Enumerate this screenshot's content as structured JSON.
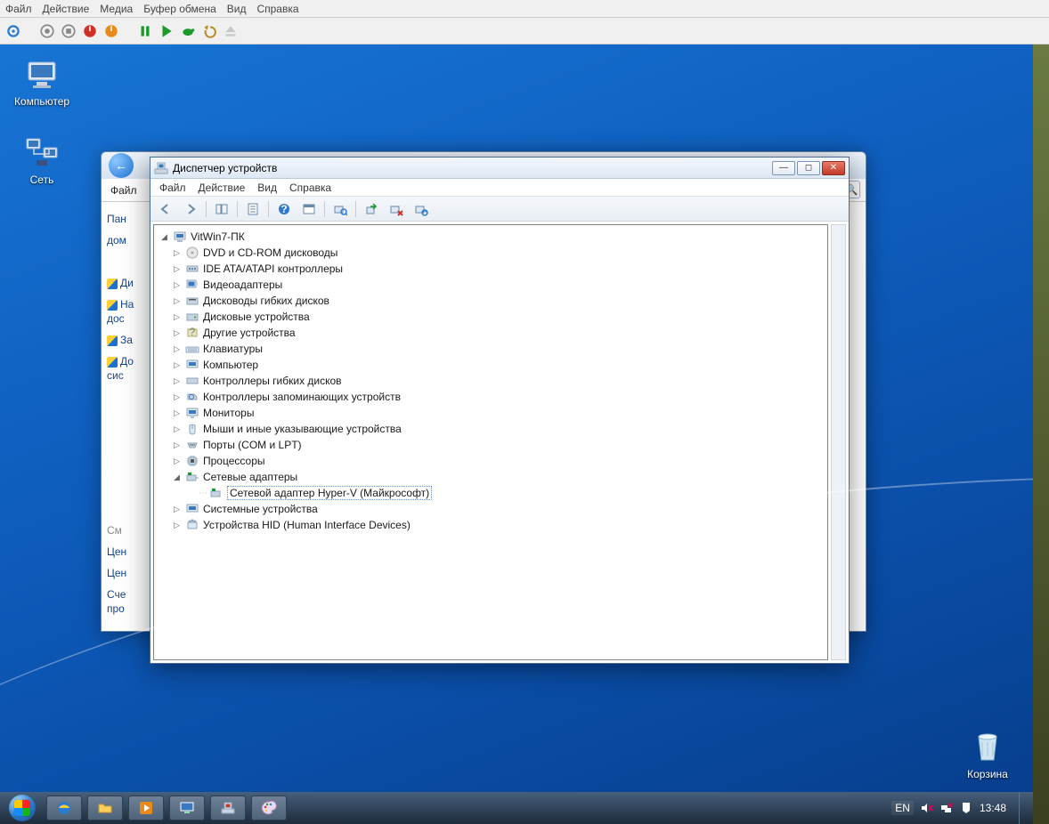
{
  "host": {
    "menu": {
      "file": "Файл",
      "action": "Действие",
      "media": "Медиа",
      "clipboard": "Буфер обмена",
      "view": "Вид",
      "help": "Справка"
    }
  },
  "desktop": {
    "computer": "Компьютер",
    "network": "Сеть",
    "recycle": "Корзина"
  },
  "cp": {
    "tab_file": "Файл",
    "side": {
      "panel": "Пан",
      "home": "дом",
      "disp": "Ди",
      "settings": "На",
      "dos": "дос",
      "protect": "За",
      "extra": "До",
      "sys": "сис",
      "see": "См",
      "center1": "Цен",
      "center2": "Цен",
      "acc": "Сче",
      "pro": "про"
    }
  },
  "dm": {
    "title": "Диспетчер устройств",
    "close_title": "Закрыть",
    "menu": {
      "file": "Файл",
      "action": "Действие",
      "view": "Вид",
      "help": "Справка"
    },
    "root": "VitWin7-ПК",
    "items": [
      "DVD и CD-ROM дисководы",
      "IDE ATA/ATAPI контроллеры",
      "Видеоадаптеры",
      "Дисководы гибких дисков",
      "Дисковые устройства",
      "Другие устройства",
      "Клавиатуры",
      "Компьютер",
      "Контроллеры гибких дисков",
      "Контроллеры запоминающих устройств",
      "Мониторы",
      "Мыши и иные указывающие устройства",
      "Порты (COM и LPT)",
      "Процессоры",
      "Сетевые адаптеры",
      "Системные устройства",
      "Устройства HID (Human Interface Devices)"
    ],
    "net_child": "Сетевой адаптер Hyper-V (Майкрософт)"
  },
  "taskbar": {
    "lang": "EN",
    "clock": "13:48"
  }
}
